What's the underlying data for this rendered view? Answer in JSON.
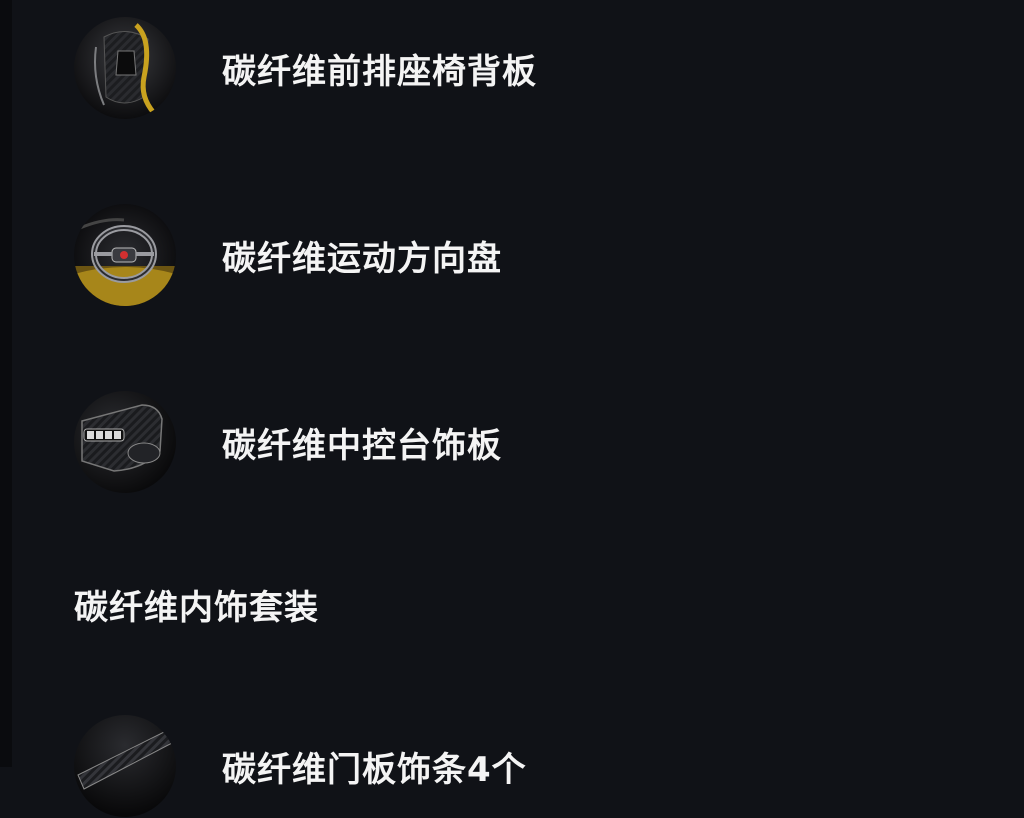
{
  "items": [
    {
      "label": "碳纤维前排座椅背板",
      "icon": "seat-back-icon"
    },
    {
      "label": "碳纤维运动方向盘",
      "icon": "steering-wheel-icon"
    },
    {
      "label": "碳纤维中控台饰板",
      "icon": "center-console-icon"
    }
  ],
  "section": {
    "title": "碳纤维内饰套装"
  },
  "partial_item": {
    "label": "碳纤维门板饰条4个",
    "icon": "door-trim-icon"
  },
  "colors": {
    "background": "#101217",
    "text": "#f4f4f4",
    "accent_yellow": "#c9a21f"
  }
}
